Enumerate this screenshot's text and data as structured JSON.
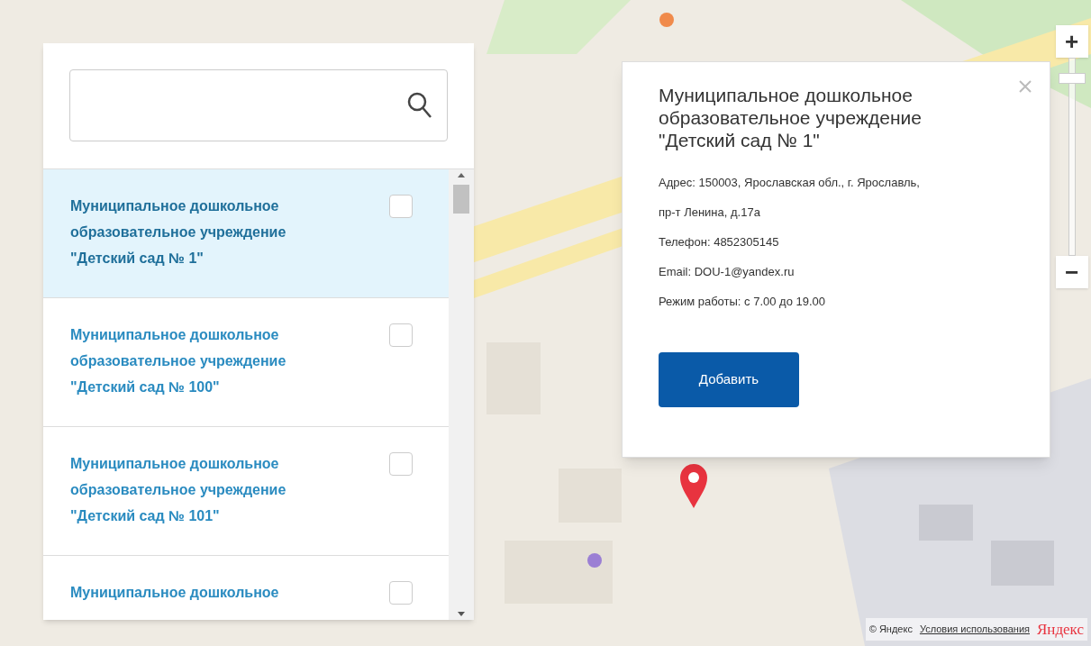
{
  "list": [
    {
      "name": "Муниципальное дошкольное образовательное учреждение \"Детский сад № 1\"",
      "selected": true,
      "checked": false
    },
    {
      "name": "Муниципальное дошкольное образовательное учреждение \"Детский сад № 100\"",
      "selected": false,
      "checked": false
    },
    {
      "name": "Муниципальное дошкольное образовательное учреждение \"Детский сад № 101\"",
      "selected": false,
      "checked": false
    },
    {
      "name": "Муниципальное дошкольное",
      "selected": false,
      "checked": false
    }
  ],
  "popup": {
    "title": "Муниципальное дошкольное образовательное учреждение \"Детский сад № 1\"",
    "lines": [
      "Адрес: 150003, Ярославская обл., г. Ярославль, пр-т Ленина, д.17а",
      "Телефон: 4852305145",
      "Email: DOU-1@yandex.ru",
      "Режим работы: с 7.00 до 19.00"
    ],
    "button": "Добавить"
  },
  "zoom": {
    "plus": "+",
    "minus": "−",
    "level": 0.9
  },
  "footer": {
    "copyright": "© Яндекс",
    "terms": "Условия использования",
    "logo": "Яндекс"
  }
}
